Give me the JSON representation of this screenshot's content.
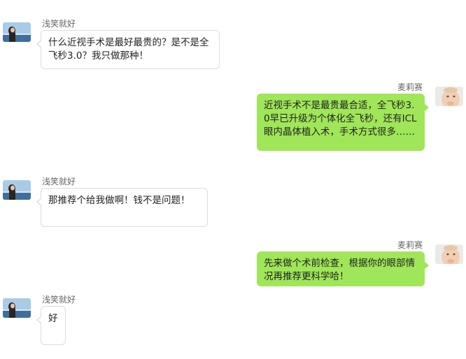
{
  "chat": {
    "messages": [
      {
        "sender": "浅笑就好",
        "text": "什么近视手术是最好最贵的？是不是全飞秒3.0？我只做那种！",
        "side": "left",
        "avatar_icon": "beach-woman-avatar-icon"
      },
      {
        "sender": "麦莉赛",
        "text": "近视手术不是最贵最合适，全飞秒3.0早已升级为个体化全飞秒，还有ICL眼内晶体植入术，手术方式很多……",
        "side": "right",
        "avatar_icon": "baby-avatar-icon"
      },
      {
        "sender": "浅笑就好",
        "text": "那推荐个给我做啊！钱不是问题！",
        "side": "left",
        "avatar_icon": "beach-woman-avatar-icon"
      },
      {
        "sender": "麦莉赛",
        "text": "先来做个术前检查，根据你的眼部情况再推荐更科学哈！",
        "side": "right",
        "avatar_icon": "baby-avatar-icon"
      },
      {
        "sender": "浅笑就好",
        "text": "好",
        "side": "left",
        "avatar_icon": "beach-woman-avatar-icon"
      }
    ]
  },
  "colors": {
    "right_bubble": "#9fe658",
    "left_bubble": "#ffffff",
    "left_border": "#dcdcdc",
    "sender_name": "#666666"
  }
}
